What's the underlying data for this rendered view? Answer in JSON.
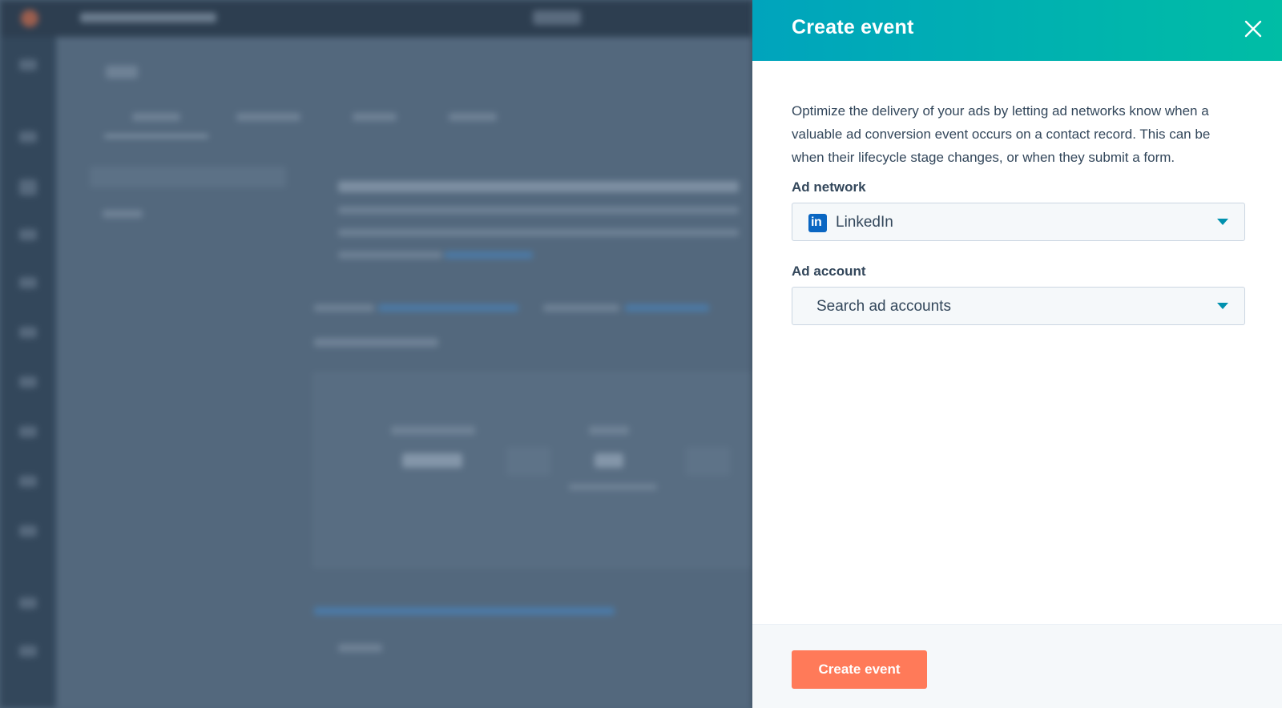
{
  "panel": {
    "title": "Create event",
    "close_icon": "close-icon",
    "description": "Optimize the delivery of your ads by letting ad networks know when a valuable ad conversion event occurs on a contact record. This can be when their lifecycle stage changes, or when they submit a form.",
    "ad_network": {
      "label": "Ad network",
      "selected": "LinkedIn",
      "icon": "linkedin-icon",
      "icon_glyph": "in"
    },
    "ad_account": {
      "label": "Ad account",
      "placeholder": "Search ad accounts"
    },
    "submit_label": "Create event"
  },
  "colors": {
    "header_gradient_start": "#00a4bd",
    "header_gradient_end": "#00bda5",
    "primary_button": "#ff7a59",
    "text": "#33475b",
    "caret": "#0091ae",
    "linkedin": "#0a66c2"
  }
}
